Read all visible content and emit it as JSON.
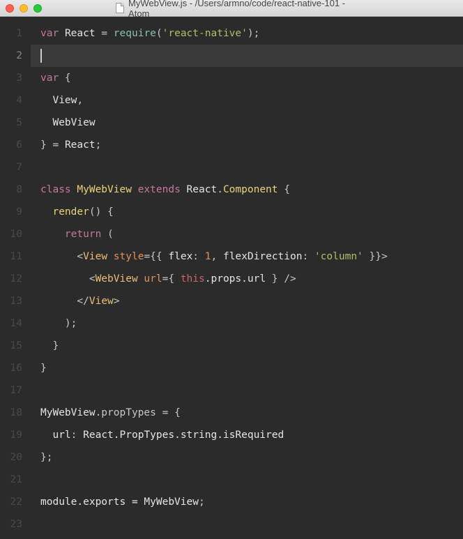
{
  "titlebar": {
    "filename": "MyWebView.js",
    "separator": " - ",
    "path": "/Users/armno/code/react-native-101",
    "app": "Atom"
  },
  "editor": {
    "activeLine": 2,
    "totalLines": 23
  },
  "code": {
    "l1": {
      "var": "var",
      "react": "React",
      "eq": " = ",
      "require": "require",
      "op": "(",
      "str": "'react-native'",
      "cp": ")",
      "semi": ";"
    },
    "l3": {
      "var": "var",
      "ob": " {"
    },
    "l4": {
      "view": "View",
      "comma": ","
    },
    "l5": {
      "webview": "WebView"
    },
    "l6": {
      "cb": "}",
      "eq": " = ",
      "react": "React",
      "semi": ";"
    },
    "l8": {
      "class": "class",
      "name": "MyWebView",
      "extends": "extends",
      "react": "React",
      "dot": ".",
      "comp": "Component",
      "ob": " {"
    },
    "l9": {
      "render": "render",
      "parens": "()",
      "ob": " {"
    },
    "l10": {
      "return": "return",
      "op": " ("
    },
    "l11": {
      "lt": "<",
      "view": "View",
      "style": "style",
      "eq1": "=",
      "ob": "{{ ",
      "flex": "flex",
      "colon1": ": ",
      "one": "1",
      "comma": ", ",
      "fd": "flexDirection",
      "colon2": ": ",
      "col": "'column'",
      "cb": " }}",
      "gt": ">"
    },
    "l12": {
      "lt": "<",
      "wv": "WebView",
      "url": "url",
      "eq": "=",
      "ob": "{ ",
      "this": "this",
      "propsurl": ".props.url",
      "cb": " }",
      "sc": " />"
    },
    "l13": {
      "lt": "</",
      "view": "View",
      "gt": ">"
    },
    "l14": {
      "cp": ");"
    },
    "l15": {
      "cb": "}"
    },
    "l16": {
      "cb": "}"
    },
    "l18": {
      "mwv": "MyWebView",
      "pt": ".propTypes = {"
    },
    "l19": {
      "url": "url",
      "colon": ": ",
      "rest": "React.PropTypes.string.isRequired"
    },
    "l20": {
      "cb": "};"
    },
    "l22": {
      "me": "module.exports = ",
      "mwv": "MyWebView",
      "semi": ";"
    }
  }
}
